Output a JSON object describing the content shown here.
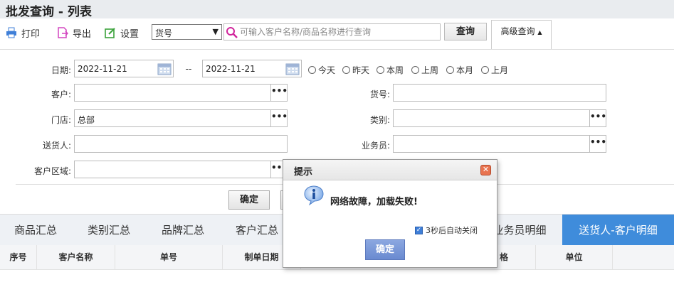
{
  "page": {
    "title": "批发查询 - 列表"
  },
  "toolbar": {
    "print_label": "打印",
    "export_label": "导出",
    "settings_label": "设置",
    "search_type": "货号",
    "search_placeholder": "可输入客户名称/商品名称进行查询",
    "query_label": "查询",
    "advanced_label": "高级查询",
    "advanced_arrow": "▲"
  },
  "filters": {
    "date_label": "日期:",
    "date_from": "2022-11-21",
    "date_sep": "--",
    "date_to": "2022-11-21",
    "quick_ranges": [
      "今天",
      "昨天",
      "本周",
      "上周",
      "本月",
      "上月"
    ],
    "customer_label": "客户:",
    "customer_value": "",
    "item_no_label": "货号:",
    "item_no_value": "",
    "store_label": "门店:",
    "store_value": "总部",
    "category_label": "类别:",
    "category_value": "",
    "deliverer_label": "送货人:",
    "deliverer_value": "",
    "salesman_label": "业务员:",
    "salesman_value": "",
    "region_label": "客户区域:",
    "region_value": "",
    "dots": "•••",
    "confirm_label": "确定"
  },
  "tabs": [
    "商品汇总",
    "类别汇总",
    "品牌汇总",
    "客户汇总",
    "业务员明细",
    "送货人-客户明细"
  ],
  "grid": {
    "columns": [
      "序号",
      "客户名称",
      "单号",
      "制单日期",
      "格",
      "单位"
    ]
  },
  "dialog": {
    "title": "提示",
    "close_glyph": "✕",
    "message": "网络故障，加载失败!",
    "auto_close_label": "3秒后自动关闭",
    "ok_label": "确定"
  },
  "colors": {
    "active_tab": "#3f8cdb",
    "dialog_ok": "#6a8ad0",
    "close_button": "#e8734f"
  }
}
